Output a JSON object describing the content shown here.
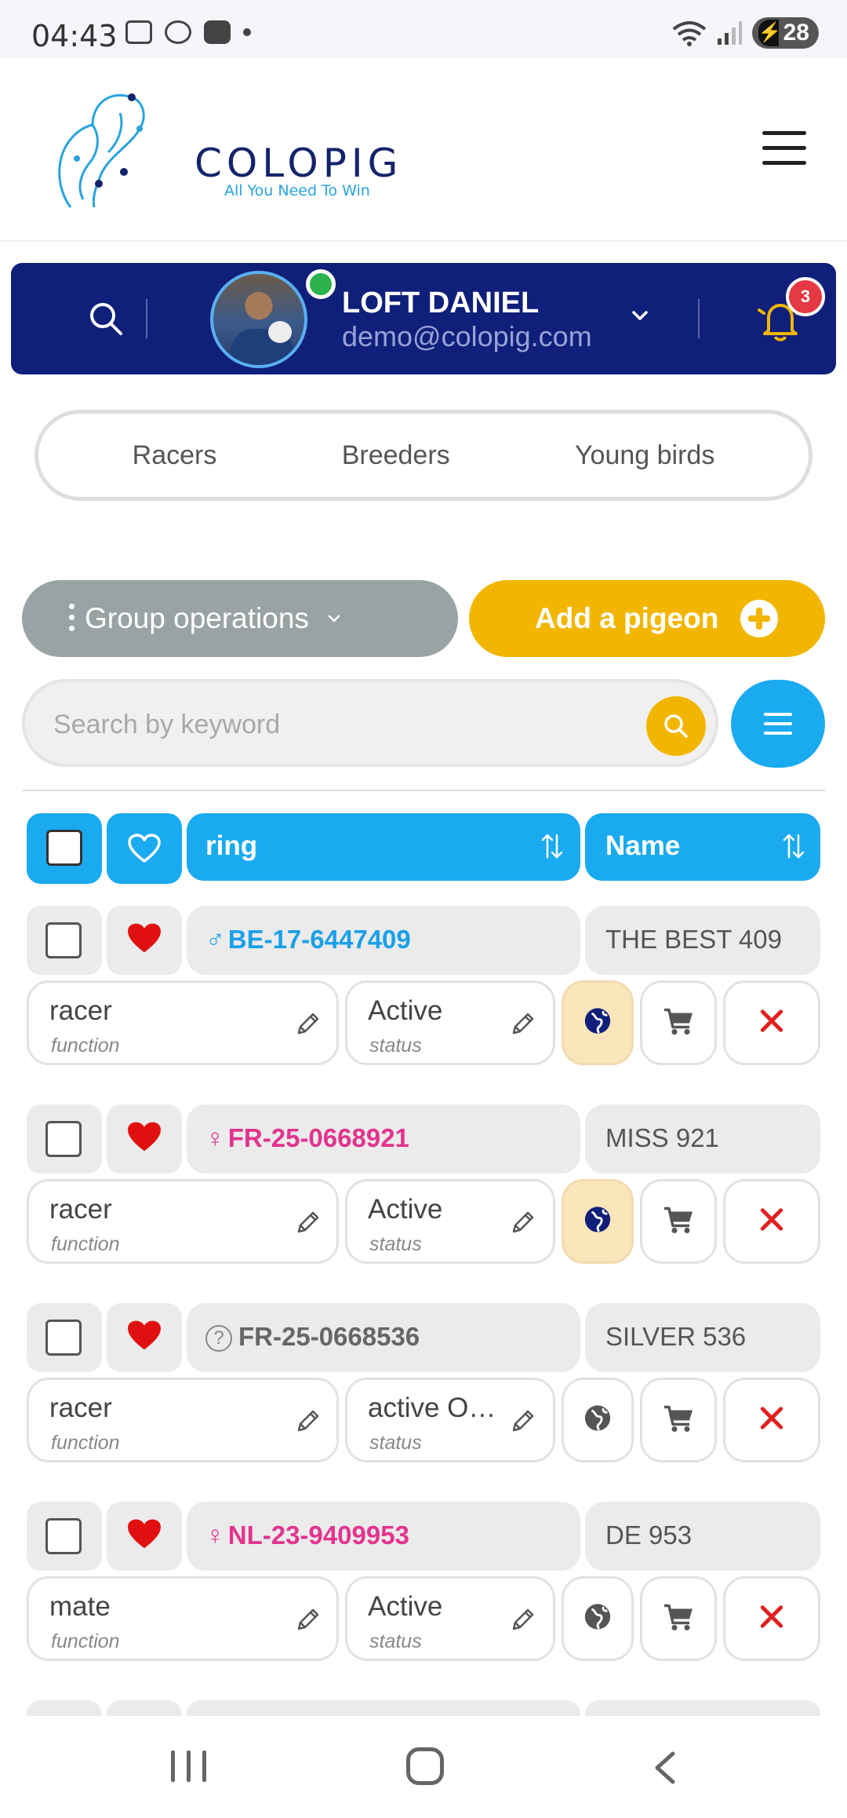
{
  "status_bar": {
    "time": "04:43",
    "battery": "28",
    "icons": [
      "screenshot-icon",
      "apps-icon",
      "youtube-icon",
      "dot-icon",
      "wifi-icon",
      "signal-icon",
      "battery-icon"
    ]
  },
  "header": {
    "brand": "COLOPIG",
    "tagline": "All You Need To Win",
    "menu_icon": "hamburger-icon"
  },
  "user": {
    "name": "LOFT DANIEL",
    "email": "demo@colopig.com",
    "notification_count": "3",
    "online": true
  },
  "tabs": [
    "Racers",
    "Breeders",
    "Young birds"
  ],
  "actions": {
    "group_operations": "Group operations",
    "add_pigeon": "Add a pigeon"
  },
  "search": {
    "placeholder": "Search by keyword",
    "value": ""
  },
  "table": {
    "columns": [
      "ring",
      "Name"
    ],
    "rows": [
      {
        "sex": "male",
        "sex_symbol": "♂",
        "ring": "BE-17-6447409",
        "name": "THE BEST 409",
        "favorite": true,
        "function": "racer",
        "function_label": "function",
        "status": "Active",
        "status_label": "status",
        "globe_active": true
      },
      {
        "sex": "female",
        "sex_symbol": "♀",
        "ring": "FR-25-0668921",
        "name": "MISS 921",
        "favorite": true,
        "function": "racer",
        "function_label": "function",
        "status": "Active",
        "status_label": "status",
        "globe_active": true
      },
      {
        "sex": "unknown",
        "sex_symbol": "?",
        "ring": "FR-25-0668536",
        "name": "SILVER 536",
        "favorite": true,
        "function": "racer",
        "function_label": "function",
        "status": "active OL...",
        "status_label": "status",
        "globe_active": false
      },
      {
        "sex": "female",
        "sex_symbol": "♀",
        "ring": "NL-23-9409953",
        "name": "DE 953",
        "favorite": true,
        "function": "mate",
        "function_label": "function",
        "status": "Active",
        "status_label": "status",
        "globe_active": false
      }
    ]
  },
  "colors": {
    "navy": "#0f1f7a",
    "accent_blue": "#1aaaf0",
    "accent_yellow": "#f2b600",
    "male": "#1aa0e8",
    "female": "#e2348e",
    "unknown": "#666666",
    "delete_red": "#e02020",
    "heart_red": "#e01010"
  }
}
